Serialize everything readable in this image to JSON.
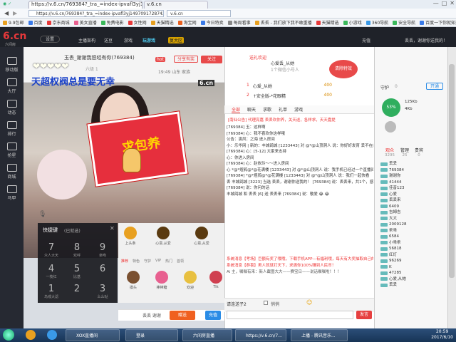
{
  "browser": {
    "tab1_url_title": "https://v.6.cn/769384?_tra_=index-ipvafl3yj1497091728742",
    "tab2_title": "v.6.cn",
    "url": "https://v.6.cn/769384?_tra_=index-ipvafl3yj1497091728742",
    "bookmarks": [
      "9.9包邮",
      "百度",
      "京东商城",
      "美女直播",
      "免费电影",
      "女性网",
      "天猫精选",
      "淘宝网",
      "今日特卖",
      "每周看事",
      "丢丢 - 我们放下我不敢重播",
      "天猫精选",
      "小游戏",
      "360导航",
      "安全导航",
      "百度一下你就知道"
    ]
  },
  "site": {
    "logo": "6.cn",
    "logo_sub": "六间房",
    "settings": "设置",
    "nav": [
      "主播架构",
      "送豆",
      "游戏",
      "玩游戏",
      "复大区"
    ],
    "header_right": [
      "充值",
      "丢丢，谢谢你送我的！"
    ],
    "sidebar": [
      "移动版",
      "大厅",
      "动态",
      "排行",
      "抢星",
      "商城",
      "马甲"
    ]
  },
  "anchor": {
    "name": "玉丢_谢谢我怒经有你(769384)",
    "level_label": "六级 1",
    "room_info": "19:49  山东  家族",
    "follow_label": "关注",
    "share_label": "分享有奖",
    "hot_label": "hot",
    "overlay_text": "天超权阀总是要无幸",
    "heart_text": "❤❤❤❤❤",
    "envelope_text": "求包养",
    "video_logo": "6.cn"
  },
  "fans": {
    "top_label": "送礼欢迎",
    "banner": "清除特效",
    "row1": [
      "心爱丢_从她",
      "1个微信小号人"
    ],
    "ranks": [
      {
        "rank": "1",
        "name": "心爱_从她",
        "score": "400"
      },
      {
        "rank": "2",
        "name": "↑安全版-*花眼精",
        "score": "400"
      }
    ]
  },
  "chat_tabs": [
    "全部",
    "聊天",
    "求歌",
    "礼单",
    "游戏"
  ],
  "chat_notice": "[南仙公告] 代理亮嘉 丢丢欢你养，关天送，各样求，天天嘉提",
  "chat_messages": [
    "[769384] 玉：这样啊",
    "[769384] 心：我不喜欢你这样哦",
    "公告：演风：之海 进入房间",
    "小：乐华网 | 新的：丰城鸽城 [1233443] 对 @*@山顶洞人 说：你好好发育 丢不在能是个人",
    "[769384] 心：[5-12] 大家来支持",
    "心：你进入房间",
    "[769384] 心：赵依玲～～进入房间",
    "心 *@*煜鸦@*@花满楼 [1233443] 对 @*@山顶洞人 说：我手机已经过一个直播间",
    "[769384] *@*煜鸦@*@花满楼 [1233443] 对 @*@山顶洞人 说：我们一起快看",
    "丢 丰城鸽城 [3223] 当选 丢丢，谢谢你送我的！ [769384] 说：丢丢来，共1个，感谢丰城鸽城的陪伴",
    "[769384] 说：你问的话",
    "丰城鸽城 和 丢丢 [6] 送 丢丢来 [769384] 说：敬爱 😂 😂"
  ],
  "system_messages": [
    "系统消息【考场】巨额有奖了哦哦，下载手机APP—有福利哦，每天有大奖抽取自己的号积分报到哦",
    "系统消息【恭喜】男人就就打天下，求遇你100%赚到人民币！",
    "Ai 主，嘱嘱有来：新人截图大大——赛宝日——说话嘱嘱啦！！！"
  ],
  "chat_input": {
    "placeholder": "请连送子2",
    "private_label": "悄悄",
    "send_label": "发言"
  },
  "gift_panel": {
    "title": "快捷键",
    "subtitle": "(已就选)",
    "keys": [
      {
        "key": "7",
        "label": "众人大天"
      },
      {
        "key": "8",
        "label": "欢呼"
      },
      {
        "key": "9",
        "label": "亲吻"
      },
      {
        "key": "4",
        "label": "一枝红"
      },
      {
        "key": "5",
        "label": "比基"
      },
      {
        "key": "6",
        "label": ""
      },
      {
        "key": "1",
        "label": "鸟戒大滤"
      },
      {
        "key": "2",
        "label": ""
      },
      {
        "key": "3",
        "label": "么么哒"
      }
    ],
    "grid_items": [
      "上头条",
      "心意,从爱",
      "心意,从爱",
      "推荐",
      "特色",
      "守护",
      "VIP",
      "热门",
      "首领",
      "摸头",
      "棒棒糖",
      "欢迎",
      "Tik"
    ],
    "send_to": "丢丢 谢谢",
    "gift_label": "赠送",
    "quick_label": "充值"
  },
  "right_panel": {
    "guard_label": "守护",
    "guard_count": "0",
    "open_label": "开通",
    "tabs": [
      "观众",
      "管理",
      "贵宾"
    ],
    "tab_counts": [
      "3295",
      "25",
      "0"
    ],
    "rank_pct": "53%",
    "prog1": "125Kb",
    "prog2": "4Kb",
    "users": [
      "丢丢",
      "769384",
      "谢谢你",
      "41444",
      "佳音123",
      "心爱",
      "丢丢来",
      "6409",
      "吉姆吉",
      "大大",
      "2009128",
      "乖乖",
      "6584",
      "小乖乖",
      "56818",
      "红灯",
      "96269",
      "K",
      "47285",
      "心爱,从她",
      "丢丢"
    ]
  },
  "taskbar": {
    "items": [
      "XOX直播间",
      "登录",
      "六间房直播",
      "https://v.6.cn/7...",
      "上播 - 腾讯音乐..."
    ],
    "time": "20:59",
    "date": "2017/6/10"
  }
}
